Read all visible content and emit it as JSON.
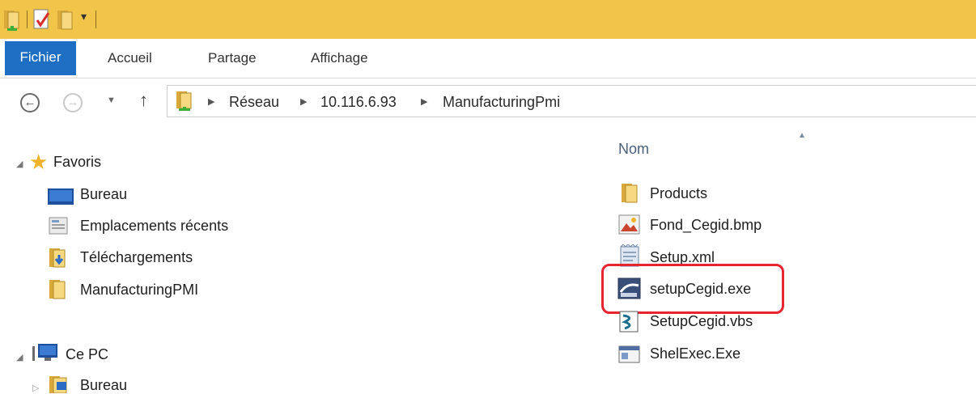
{
  "colors": {
    "titlebar": "#f0c54a",
    "file_tab": "#1e6fc4",
    "highlight": "#e6252e"
  },
  "ribbon": {
    "tabs": [
      {
        "label": "Fichier",
        "active": true
      },
      {
        "label": "Accueil"
      },
      {
        "label": "Partage"
      },
      {
        "label": "Affichage"
      }
    ]
  },
  "toolbar": {
    "quick_access_dropdown": "▾"
  },
  "address": {
    "crumbs": [
      "Réseau",
      "10.116.6.93",
      "ManufacturingPmi"
    ]
  },
  "nav": {
    "favorites": {
      "label": "Favoris",
      "items": [
        {
          "label": "Bureau",
          "icon": "desktop-icon"
        },
        {
          "label": "Emplacements récents",
          "icon": "recent-places-icon"
        },
        {
          "label": "Téléchargements",
          "icon": "downloads-folder-icon"
        },
        {
          "label": "ManufacturingPMI",
          "icon": "folder-icon"
        }
      ]
    },
    "this_pc": {
      "label": "Ce PC",
      "items": [
        {
          "label": "Bureau",
          "icon": "desktop-folder-icon"
        }
      ]
    }
  },
  "files": {
    "column_name": "Nom",
    "items": [
      {
        "name": "Products",
        "icon": "folder-icon"
      },
      {
        "name": "Fond_Cegid.bmp",
        "icon": "bitmap-icon"
      },
      {
        "name": "Setup.xml",
        "icon": "xml-file-icon"
      },
      {
        "name": "setupCegid.exe",
        "icon": "installer-icon",
        "highlighted": true
      },
      {
        "name": "SetupCegid.vbs",
        "icon": "script-icon"
      },
      {
        "name": "ShelExec.Exe",
        "icon": "exe-window-icon"
      }
    ]
  }
}
